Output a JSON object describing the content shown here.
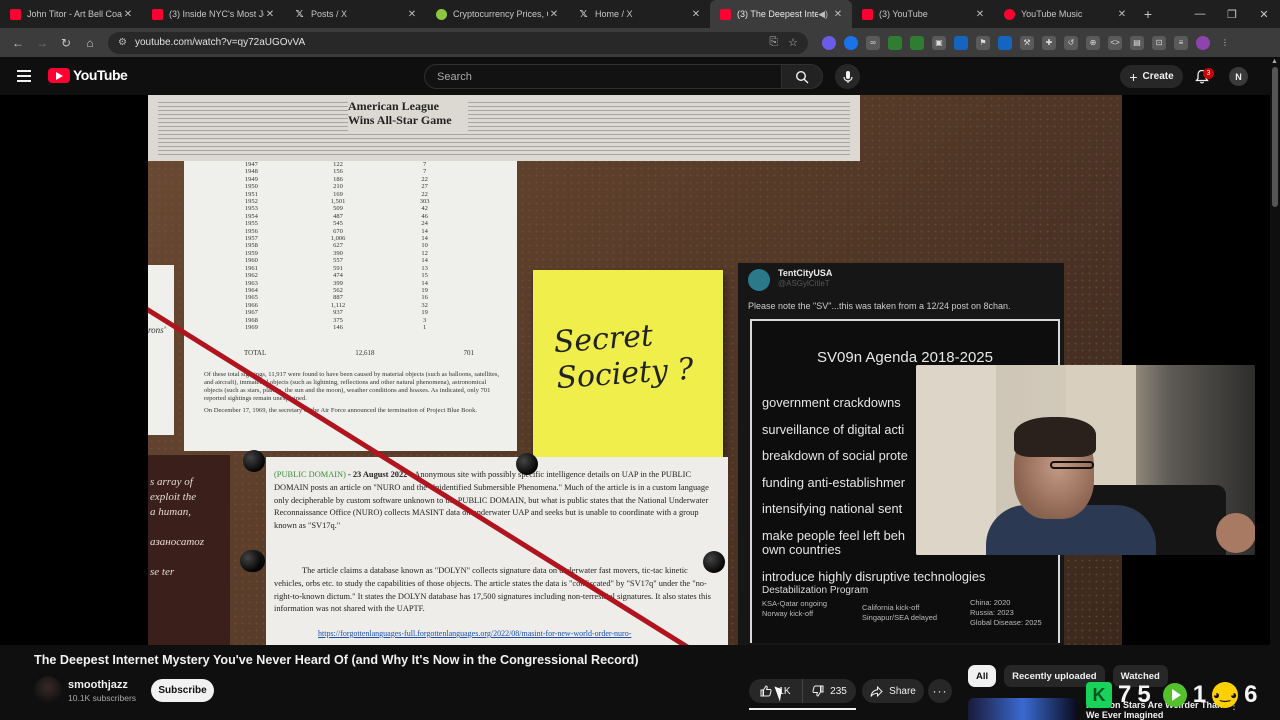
{
  "browser": {
    "tabs": [
      {
        "title": "John Titor - Art Bell Coast",
        "icon": "youtube-icon"
      },
      {
        "title": "(3) Inside NYC's Most Jewi",
        "icon": "youtube-icon"
      },
      {
        "title": "Posts / X",
        "icon": "x-icon"
      },
      {
        "title": "Cryptocurrency Prices, Ch",
        "icon": "coingecko-icon"
      },
      {
        "title": "Home / X",
        "icon": "x-icon"
      },
      {
        "title": "(3) The Deepest Intern",
        "icon": "youtube-icon",
        "active": true
      },
      {
        "title": "(3) YouTube",
        "icon": "youtube-icon"
      },
      {
        "title": "YouTube Music",
        "icon": "youtube-music-icon"
      }
    ],
    "url": "youtube.com/watch?v=qy72aUGOvVA"
  },
  "youtube": {
    "logo_text": "YouTube",
    "search_placeholder": "Search",
    "create_label": "Create",
    "notification_count": "3",
    "avatar_initial": "N"
  },
  "video_frame": {
    "news_headline": "American League Wins All-Star Game",
    "table_rows": [
      [
        "1947",
        "122",
        "7"
      ],
      [
        "1948",
        "156",
        "7"
      ],
      [
        "1949",
        "186",
        "22"
      ],
      [
        "1950",
        "210",
        "27"
      ],
      [
        "1951",
        "169",
        "22"
      ],
      [
        "1952",
        "1,501",
        "303"
      ],
      [
        "1953",
        "509",
        "42"
      ],
      [
        "1954",
        "487",
        "46"
      ],
      [
        "1955",
        "545",
        "24"
      ],
      [
        "1956",
        "670",
        "14"
      ],
      [
        "1957",
        "1,006",
        "14"
      ],
      [
        "1958",
        "627",
        "10"
      ],
      [
        "1959",
        "390",
        "12"
      ],
      [
        "1960",
        "557",
        "14"
      ],
      [
        "1961",
        "591",
        "13"
      ],
      [
        "1962",
        "474",
        "15"
      ],
      [
        "1963",
        "399",
        "14"
      ],
      [
        "1964",
        "562",
        "19"
      ],
      [
        "1965",
        "887",
        "16"
      ],
      [
        "1966",
        "1,112",
        "32"
      ],
      [
        "1967",
        "937",
        "19"
      ],
      [
        "1968",
        "375",
        "3"
      ],
      [
        "1969",
        "146",
        "1"
      ]
    ],
    "table_total_label": "TOTAL",
    "table_total_value": "12,618",
    "table_total_unexplained": "701",
    "table_paragraph": "Of these total sightings, 11,917 were found to have been caused by material objects (such as balloons, satellites, and aircraft), immaterial objects (such as lightning, reflections and other natural phenomena), astronomical objects (such as stars, planets, the sun and the moon), weather conditions and hoaxes. As indicated, only 701 reported sightings remain unexplained.",
    "table_paragraph_2": "On December 17, 1969, the secretary of the Air Force announced the termination of Project Blue Book.",
    "left_strip_text": "rons'",
    "left_dark_text": [
      "s array of",
      "exploit the",
      "a human,",
      "",
      "азаносатоz",
      "",
      "se ter"
    ],
    "sticky_note": "Secret Society ?",
    "doc_source": "(PUBLIC DOMAIN)",
    "doc_date": " - 23 August 2022 - ",
    "doc_para_1": "Anonymous site with possibly specific intelligence details on UAP in the PUBLIC DOMAIN posts an article on \"NURO and the Unidentified Submersible Phenomena.\" Much of the article is in a custom language only decipherable by custom software unknown to the PUBLIC DOMAIN, but what is public states that the National Underwater Reconnaissance Office (NURO) collects MASINT data on underwater UAP and seeks but is unable to coordinate with a group known as \"SV17q.\"",
    "doc_para_2": "The article claims a database known as \"DOLYN\" collects signature data on underwater fast movers, tic-tac kinetic vehicles, orbs etc. to study the capabilities of those objects. The article states the data is \"confiscated\" by \"SV17q\" under the \"no-right-to-known dictum.\" It states the DOLYN database has 17,500 signatures including non-terrestrial signatures. It also states this information was not shared with the UAPTF.",
    "doc_link": "https://forgottenlanguages-full.forgottenlanguages.org/2022/08/masint-for-new-world-order-nuro-",
    "tweet_name": "TentCityUSA",
    "tweet_handle": "@ASGylCitieT",
    "tweet_text": "Please note the \"SV\"...this was taken from a 12/24 post on 8chan.",
    "agenda_title": "SV09n Agenda 2018-2025",
    "agenda_items": [
      "government crackdowns",
      "surveillance of digital acti",
      "breakdown of social prote",
      "funding anti-establishmer",
      "intensifying national sent",
      "make people feel left beh",
      "introduce highly disruptive technologies"
    ],
    "agenda_item_continuation": "own countries",
    "agenda_program": "Destabilization Program",
    "agenda_program_lines": [
      "KSA-Qatar ongoing",
      "Norway kick-off"
    ],
    "agenda_program_mid": [
      "California kick-off",
      "Singapur/SEA delayed"
    ],
    "agenda_program_right": [
      "China: 2020",
      "Russia: 2023",
      "Global Disease: 2025"
    ]
  },
  "video": {
    "title": "The Deepest Internet Mystery You've Never Heard Of (and Why It's Now in the Congressional Record)",
    "channel": "smoothjazz",
    "subscribers": "10.1K subscribers",
    "subscribe_label": "Subscribe",
    "likes": "1K",
    "dislikes": "235",
    "share_label": "Share"
  },
  "sidebar": {
    "chips": [
      "All",
      "Recently uploaded",
      "Watched"
    ],
    "selected_chip": "All",
    "rec_title": "Neutron Stars Are Weirder Than We Ever Imagined"
  },
  "overlay": {
    "k_value": "75",
    "play_value": "1",
    "emoji_value": "6"
  }
}
